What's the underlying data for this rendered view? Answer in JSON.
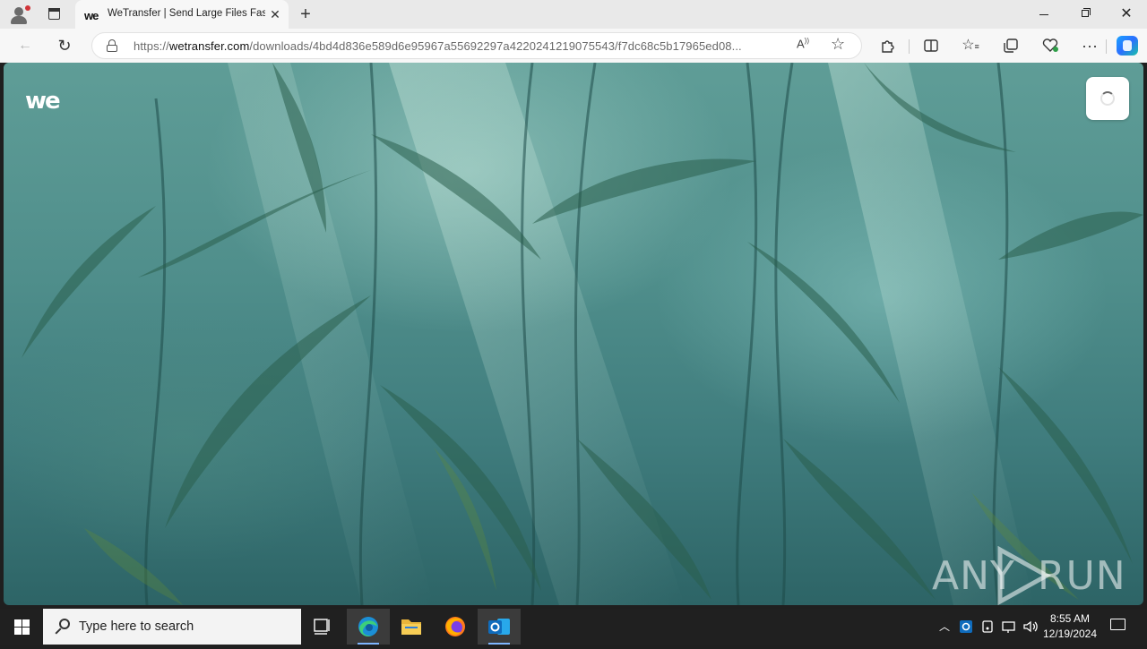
{
  "browser": {
    "tab": {
      "title": "WeTransfer | Send Large Files Fast",
      "favicon_text": "we"
    },
    "window_controls": [
      "minimize",
      "restore",
      "close"
    ],
    "address": {
      "scheme": "https://",
      "host": "wetransfer.com",
      "path": "/downloads/4bd4d836e589d6e95967a55692297a4220241219075543/f7dc68c5b17965ed08..."
    },
    "toolbar_icons": [
      "back-icon",
      "refresh-icon",
      "lock-icon",
      "read-aloud-icon",
      "favorite-star-icon",
      "extensions-icon",
      "split-screen-icon",
      "favorites-icon",
      "collections-icon",
      "browser-essentials-icon",
      "more-icon",
      "copilot-icon"
    ]
  },
  "page": {
    "logo_text": "we",
    "menu_state": "loading",
    "watermark_text_left": "ANY",
    "watermark_text_right": "RUN"
  },
  "taskbar": {
    "search_placeholder": "Type here to search",
    "apps": [
      "task-view-icon",
      "edge-icon",
      "file-explorer-icon",
      "firefox-icon",
      "outlook-icon"
    ],
    "active_app": "edge-icon",
    "time": "8:55 AM",
    "date": "12/19/2024",
    "tray_icons": [
      "chevron-up-icon",
      "outlook-tray-icon",
      "network-device-icon",
      "network-icon",
      "volume-icon"
    ]
  }
}
